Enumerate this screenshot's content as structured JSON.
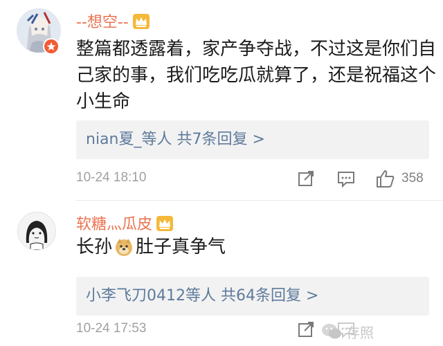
{
  "comments": [
    {
      "username": "--想空--",
      "avatar_icon": "anime-girl-avatar",
      "has_vip_badge": true,
      "content": "整篇都透露着，家产争夺战，不过这是你们自己家的事，我们吃吃瓜就算了，还是祝福这个小生命",
      "replies_text": "nian夏_等人  共7条回复 >",
      "timestamp": "10-24 18:10",
      "like_count": "358"
    },
    {
      "username": "软糖灬瓜皮",
      "avatar_icon": "girl-sketch-avatar",
      "content_before": "长孙",
      "content_emoji": "doge-emoji",
      "content_after": "肚子真争气",
      "replies_text": "小李飞刀0412等人  共64条回复 >",
      "timestamp": "10-24 17:53",
      "like_count": ""
    }
  ],
  "watermark": {
    "text": "存照"
  },
  "colors": {
    "username": "#eb7350",
    "link": "#5e7a9c",
    "text": "#1a1a1a",
    "meta": "#a0a0a0",
    "reply_bg": "#f2f2f2",
    "crown": "#f5b93a"
  }
}
